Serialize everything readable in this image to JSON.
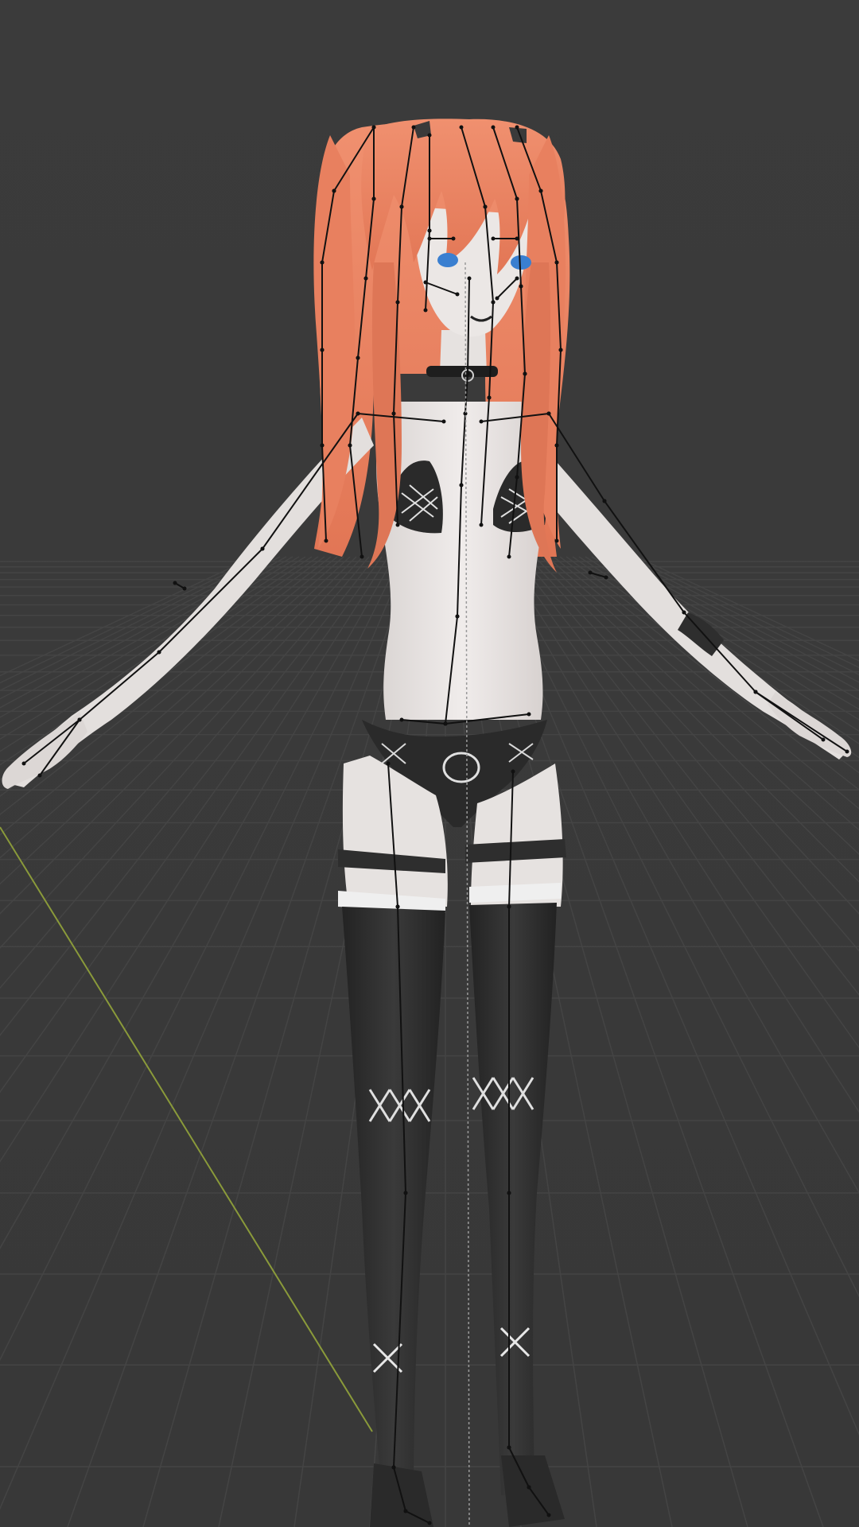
{
  "viewport": {
    "mode": "3d-viewport",
    "content": "armature-model"
  },
  "colors": {
    "background": "#3a3a3a",
    "grid_line": "#4a4a4a",
    "axis_y": "#8a9a3a",
    "skin": "#e6e2e0",
    "hair": "#e8836a",
    "hair_shadow": "#d46a4e",
    "clothing": "#2c2c2c",
    "bone": "#111111",
    "eyes": "#3a7fd0"
  }
}
